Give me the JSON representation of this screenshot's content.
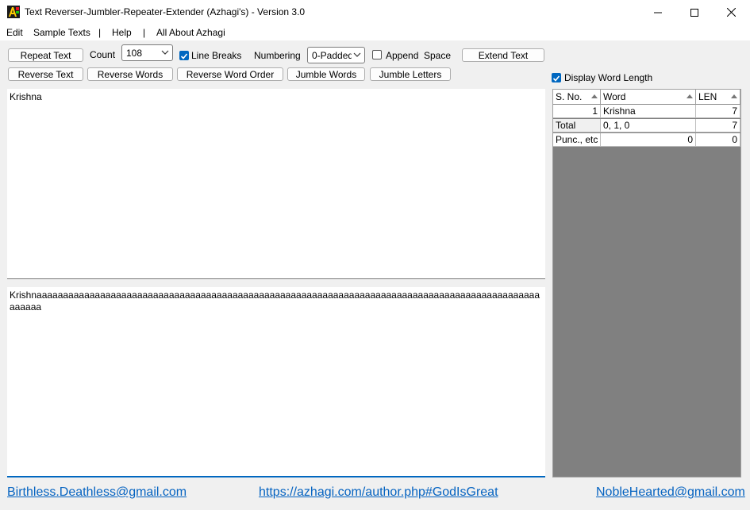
{
  "window": {
    "title": "Text Reverser-Jumbler-Repeater-Extender (Azhagi's) - Version 3.0"
  },
  "menu": {
    "items": [
      "Edit",
      "Sample Texts",
      "|",
      "Help",
      "|",
      "All About Azhagi"
    ]
  },
  "toolbar": {
    "repeat_text": "Repeat Text",
    "count_label": "Count",
    "count_value": "108",
    "line_breaks_label": "Line Breaks",
    "line_breaks_checked": true,
    "numbering_label": "Numbering",
    "numbering_value": "0-Padded",
    "append_label": "Append",
    "space_label": "Space",
    "append_checked": false,
    "extend_text": "Extend Text",
    "reverse_text": "Reverse Text",
    "reverse_words": "Reverse Words",
    "reverse_word_order": "Reverse Word Order",
    "jumble_words": "Jumble Words",
    "jumble_letters": "Jumble Letters"
  },
  "display_word_length": {
    "label": "Display Word Length",
    "checked": true
  },
  "input_text": "Krishna",
  "output_text": "Krishnaaaaaaaaaaaaaaaaaaaaaaaaaaaaaaaaaaaaaaaaaaaaaaaaaaaaaaaaaaaaaaaaaaaaaaaaaaaaaaaaaaaaaaaaaaaaaaaaaaaaa",
  "grid": {
    "headers": {
      "sno": "S. No.",
      "word": "Word",
      "len": "LEN"
    },
    "rows": [
      {
        "sno": "1",
        "word": "Krishna",
        "len": "7"
      }
    ],
    "total": {
      "label": "Total",
      "word": "0, 1, 0",
      "len": "7"
    },
    "punc": {
      "label": "Punc., etc",
      "word": "0",
      "len": "0"
    }
  },
  "footer": {
    "email_left": "Birthless.Deathless@gmail.com",
    "url": "https://azhagi.com/author.php#GodIsGreat",
    "email_right": "NobleHearted@gmail.com"
  },
  "colors": {
    "accent": "#0067c0",
    "link": "#0563c1",
    "grid_bg": "#808080"
  }
}
